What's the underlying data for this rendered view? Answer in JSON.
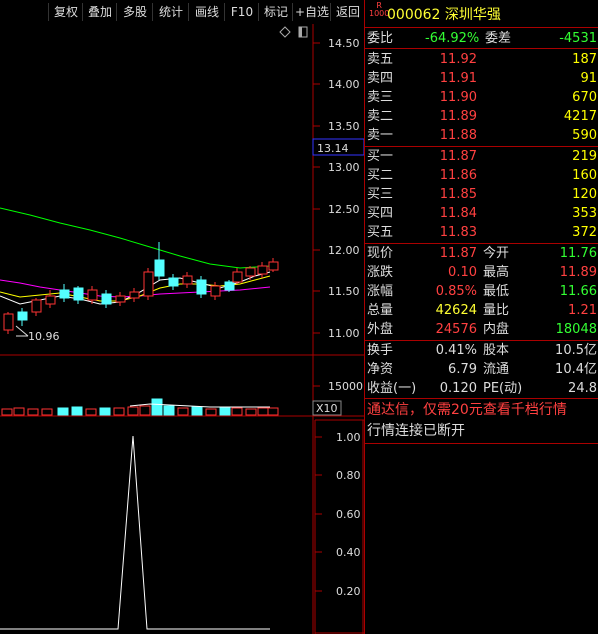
{
  "toolbar": {
    "buttons": [
      "复权",
      "叠加",
      "多股",
      "统计",
      "画线",
      "F10",
      "标记",
      "+自选",
      "返回"
    ]
  },
  "chart": {
    "price_ticks": [
      "14.50",
      "14.00",
      "13.50",
      "13.00",
      "12.50",
      "12.00",
      "11.50",
      "11.00"
    ],
    "current_price_marker": "13.14",
    "low_label": "10.96",
    "volume_tick": "15000",
    "volume_unit": "X10",
    "indicator_ticks": [
      "1.00",
      "0.80",
      "0.60",
      "0.40",
      "0.20"
    ],
    "colors": {
      "up": "#ff3333",
      "down": "#54ffff",
      "ma5": "#ffffff",
      "ma10": "#ffff00",
      "ma20": "#ff00ff",
      "ma60": "#00ff00"
    }
  },
  "stock": {
    "badge_top": "R",
    "badge_bottom": "1000",
    "code": "000062",
    "name": "深圳华强"
  },
  "ratio": {
    "weibi_label": "委比",
    "weibi_value": "-64.92%",
    "weicha_label": "委差",
    "weicha_value": "-4531"
  },
  "sell_orders": [
    {
      "label": "卖五",
      "price": "11.92",
      "volume": "187"
    },
    {
      "label": "卖四",
      "price": "11.91",
      "volume": "91"
    },
    {
      "label": "卖三",
      "price": "11.90",
      "volume": "670"
    },
    {
      "label": "卖二",
      "price": "11.89",
      "volume": "4217"
    },
    {
      "label": "卖一",
      "price": "11.88",
      "volume": "590"
    }
  ],
  "buy_orders": [
    {
      "label": "买一",
      "price": "11.87",
      "volume": "219"
    },
    {
      "label": "买二",
      "price": "11.86",
      "volume": "160"
    },
    {
      "label": "买三",
      "price": "11.85",
      "volume": "120"
    },
    {
      "label": "买四",
      "price": "11.84",
      "volume": "353"
    },
    {
      "label": "买五",
      "price": "11.83",
      "volume": "372"
    }
  ],
  "quote": [
    {
      "l1": "现价",
      "v1": "11.87",
      "l2": "今开",
      "v2": "11.76"
    },
    {
      "l1": "涨跌",
      "v1": "0.10",
      "l2": "最高",
      "v2": "11.89"
    },
    {
      "l1": "涨幅",
      "v1": "0.85%",
      "l2": "最低",
      "v2": "11.66"
    },
    {
      "l1": "总量",
      "v1": "42624",
      "l2": "量比",
      "v2": "1.21"
    },
    {
      "l1": "外盘",
      "v1": "24576",
      "l2": "内盘",
      "v2": "18048"
    }
  ],
  "stats": [
    {
      "l1": "换手",
      "v1": "0.41%",
      "l2": "股本",
      "v2": "10.5亿"
    },
    {
      "l1": "净资",
      "v1": "6.79",
      "l2": "流通",
      "v2": "10.4亿"
    },
    {
      "l1": "收益(一)",
      "v1": "0.120",
      "l2": "PE(动)",
      "v2": "24.8"
    }
  ],
  "notice": {
    "promo": "通达信，仅需20元查看千档行情",
    "status": "行情连接已断开"
  }
}
